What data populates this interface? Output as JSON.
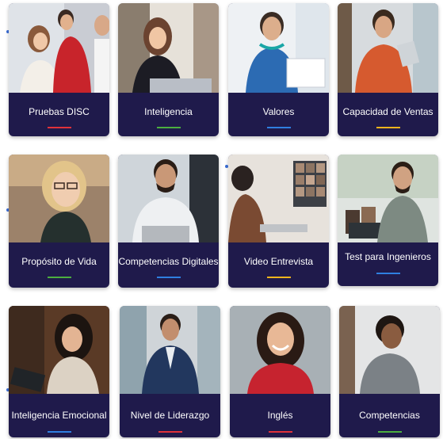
{
  "cards": [
    {
      "label": "Pruebas DISC",
      "accent": "#e0323a",
      "photo": "group-meeting-photo"
    },
    {
      "label": "Inteligencia",
      "accent": "#4cae3f",
      "photo": "woman-laptop-photo"
    },
    {
      "label": "Valores",
      "accent": "#2f7fe0",
      "photo": "man-headphones-photo"
    },
    {
      "label": "Capacidad de Ventas",
      "accent": "#f2b41d",
      "photo": "man-tablet-photo"
    },
    {
      "label": "Propósito de Vida",
      "accent": "#4cae3f",
      "photo": "woman-glasses-photo"
    },
    {
      "label": "Competencias Digitales",
      "accent": "#2f7fe0",
      "photo": "man-laptop-headset-photo"
    },
    {
      "label": "Video Entrevista",
      "accent": "#f2b41d",
      "photo": "video-call-photo"
    },
    {
      "label": "Test para Ingenieros",
      "accent": "#2f7fe0",
      "photo": "engineer-office-photo"
    },
    {
      "label": "Inteligencia Emocional",
      "accent": "#2f7fe0",
      "photo": "woman-tablet-photo"
    },
    {
      "label": "Nivel de Liderazgo",
      "accent": "#e0323a",
      "photo": "man-suit-photo"
    },
    {
      "label": "Inglés",
      "accent": "#e0323a",
      "photo": "woman-smiling-photo"
    },
    {
      "label": "Competencias",
      "accent": "#4cae3f",
      "photo": "man-curly-hair-photo"
    }
  ]
}
